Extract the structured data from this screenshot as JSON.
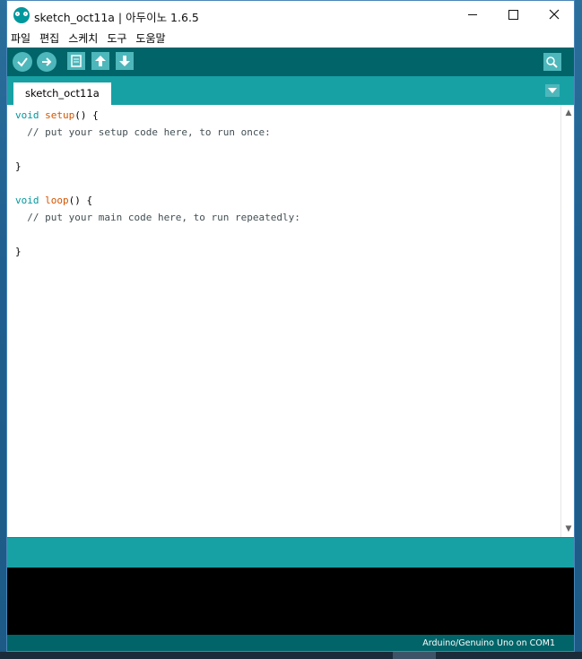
{
  "window": {
    "title": "sketch_oct11a | 아두이노 1.6.5",
    "controls": {
      "minimize": "minimize",
      "maximize": "maximize",
      "close": "close"
    }
  },
  "menu": {
    "items": [
      {
        "label": "파일"
      },
      {
        "label": "편집"
      },
      {
        "label": "스케치"
      },
      {
        "label": "도구"
      },
      {
        "label": "도움말"
      }
    ]
  },
  "toolbar": {
    "buttons": [
      {
        "name": "verify",
        "icon": "checkmark-icon"
      },
      {
        "name": "upload",
        "icon": "arrow-right-icon"
      },
      {
        "name": "new",
        "icon": "document-icon"
      },
      {
        "name": "open",
        "icon": "arrow-up-icon"
      },
      {
        "name": "save",
        "icon": "arrow-down-icon"
      }
    ],
    "serial_monitor_icon": "magnifier-icon"
  },
  "tabs": [
    {
      "label": "sketch_oct11a",
      "active": true
    }
  ],
  "editor": {
    "lines": [
      "void setup() {",
      "  // put your setup code here, to run once:",
      "",
      "}",
      "",
      "void loop() {",
      "  // put your main code here, to run repeatedly:",
      "",
      "}"
    ]
  },
  "status": {
    "board": "Arduino/Genuino Uno on COM1"
  },
  "colors": {
    "toolbar": "#006468",
    "tabbar": "#17a1a5",
    "button": "#4db7bb",
    "keyword": "#00979c",
    "function": "#d35400"
  }
}
